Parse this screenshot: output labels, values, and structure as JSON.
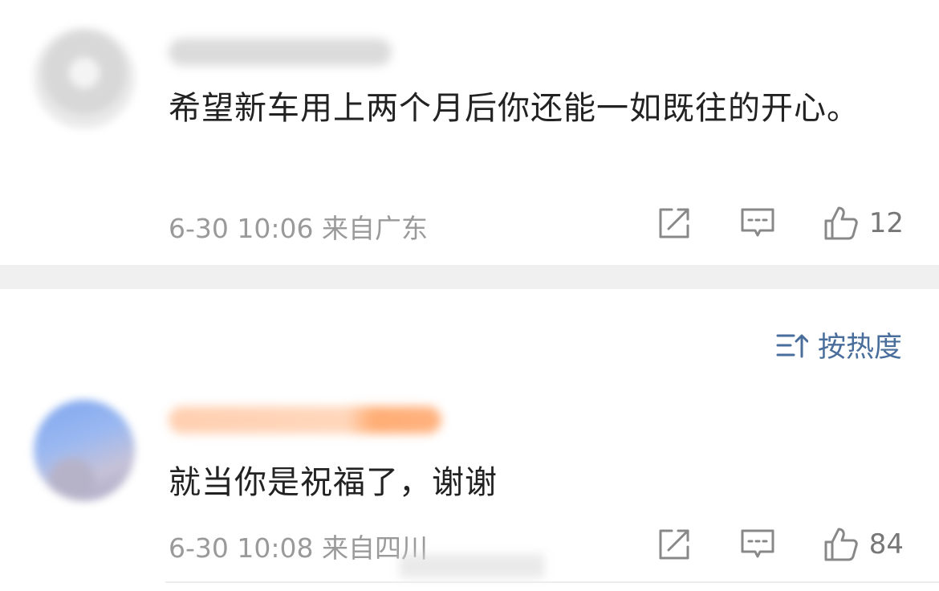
{
  "comments": [
    {
      "text": "希望新车用上两个月后你还能一如既往的开心。",
      "date": "6-30 10:06",
      "location": "来自广东",
      "likes": "12"
    },
    {
      "text": "就当你是祝福了，谢谢",
      "date": "6-30 10:08",
      "location": "来自四川",
      "likes": "84"
    }
  ],
  "sort": {
    "label": "按热度"
  },
  "icons": {
    "repost": "share-edit-icon",
    "comment": "comment-bubble-icon",
    "like": "thumbs-up-icon",
    "sort": "sort-icon"
  },
  "colors": {
    "link": "#4a6e9c",
    "meta": "#9a9a9a",
    "divider": "#f0f0f0"
  }
}
